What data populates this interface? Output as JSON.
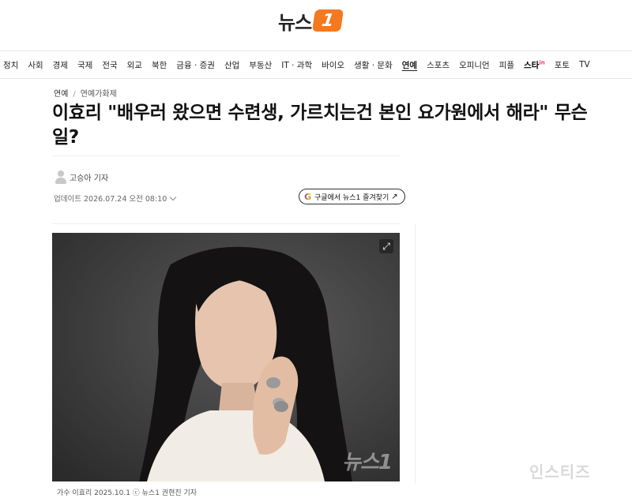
{
  "header": {
    "logo_text": "뉴스",
    "logo_badge": "1"
  },
  "nav": {
    "items": [
      "정치",
      "사회",
      "경제",
      "국제",
      "전국",
      "외교",
      "북한",
      "금융 · 증권",
      "산업",
      "부동산",
      "IT · 과학",
      "바이오",
      "생활 · 문화",
      "연예",
      "스포츠",
      "오피니언",
      "피플",
      "스타",
      "포토",
      "TV"
    ],
    "active": "연예",
    "star_suffix": "in"
  },
  "article": {
    "breadcrumb": [
      "연예",
      "연예가화제"
    ],
    "headline": "이효리 \"배우러 왔으면 수련생, 가르치는건 본인 요가원에서 해라\" 무슨 일?",
    "author": "고승아 기자",
    "updated": "업데이트 2026.07.24 오전 08:10",
    "google_button": "구글에서 뉴스1 즐겨찾기",
    "photo_watermark": "뉴스1",
    "caption": "가수 이효리 2025.10.1 ⓒ 뉴스1 권현진 기자"
  },
  "page_watermark": "인스티즈",
  "colors": {
    "brand": "#f47920",
    "text": "#111111",
    "star": "#e5407c"
  }
}
